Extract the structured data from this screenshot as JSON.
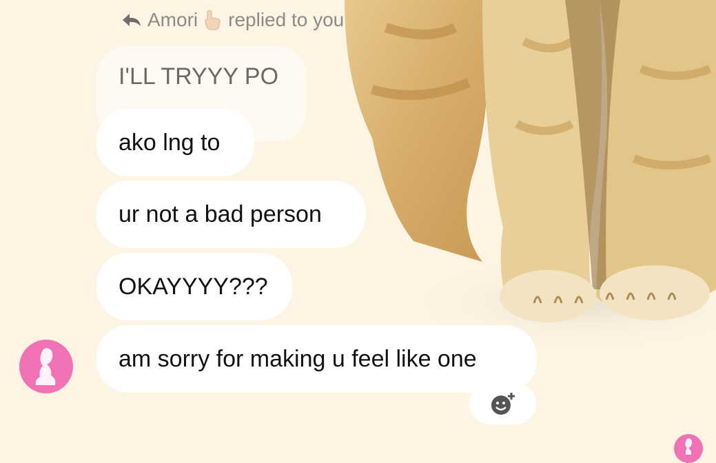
{
  "reply_header": {
    "name": "Amori",
    "text": "replied to you",
    "emoji": "pointing-hand",
    "icon": "reply-arrow-icon"
  },
  "quoted_message": "I'LL TRYYY PO",
  "messages": [
    "ako lng to",
    "ur not a bad person",
    "OKAYYYY???",
    "am sorry for making u feel like one"
  ],
  "avatar": {
    "color": "#f071b4"
  },
  "react_button": {
    "icon": "add-reaction-icon"
  },
  "colors": {
    "background": "#fdf4e3",
    "bubble": "#ffffff",
    "quoted_text": "#6b6965",
    "header_text": "#8d8a86",
    "avatar_pink": "#f071b4"
  }
}
